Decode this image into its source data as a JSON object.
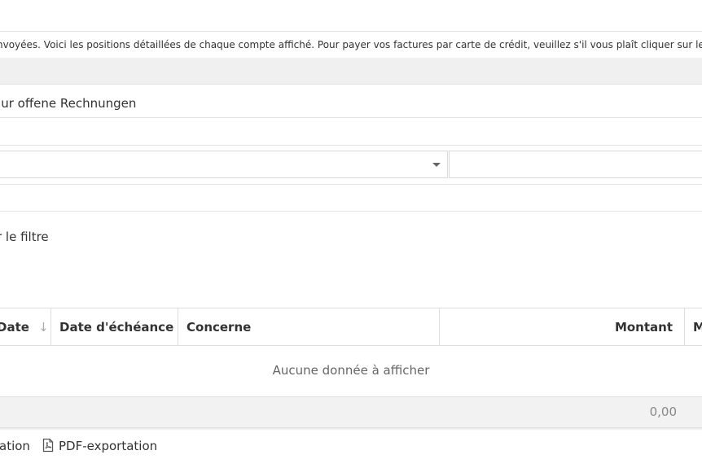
{
  "notice": {
    "text": "nvoyées. Voici les positions détaillées de chaque compte affiché. Pour payer vos factures par carte de crédit, veuillez s'il vous plaît cliquer sur le lien \"Payer main"
  },
  "filters": {
    "open_only_label": "Nur offene Rechnungen",
    "apply_filter_label": "r le filtre"
  },
  "grid": {
    "columns": [
      {
        "label": "Date",
        "sort": "descending"
      },
      {
        "label": "Date d'échéance"
      },
      {
        "label": "Concerne"
      },
      {
        "label": "Montant"
      },
      {
        "label": "M"
      }
    ],
    "empty_text": "Aucune donnée à afficher",
    "total": "0,00"
  },
  "export": {
    "other_label": "ation",
    "pdf_label": "PDF-exportation"
  },
  "icons": {
    "sort": "arrow-down-icon",
    "dropdown": "chevron-down-icon",
    "pdf": "pdf-icon"
  }
}
